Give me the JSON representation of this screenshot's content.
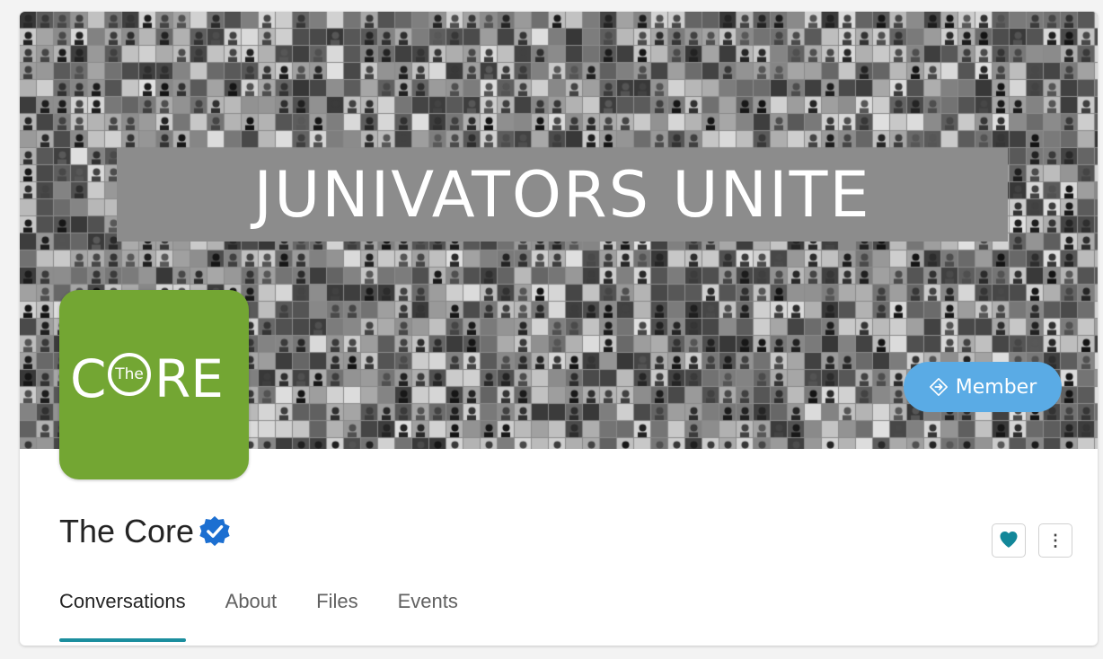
{
  "cover": {
    "banner_text": "JUNIVATORS UNITE"
  },
  "logo": {
    "letter_left": "C",
    "ring_text": "The",
    "letters_right": "RE",
    "color": "#73a633"
  },
  "member_button": {
    "label": "Member",
    "icon": "diamond-arrows-icon",
    "color": "#5aabe5"
  },
  "group": {
    "title": "The Core",
    "verified_icon": "verified-badge-icon",
    "verified_color": "#1c6fd1"
  },
  "actions": {
    "favorite_icon": "heart-icon",
    "favorite_color": "#128799",
    "more_label": "⋮"
  },
  "tabs": [
    {
      "label": "Conversations",
      "active": true
    },
    {
      "label": "About",
      "active": false
    },
    {
      "label": "Files",
      "active": false
    },
    {
      "label": "Events",
      "active": false
    }
  ],
  "accent_color": "#1b8e9e"
}
